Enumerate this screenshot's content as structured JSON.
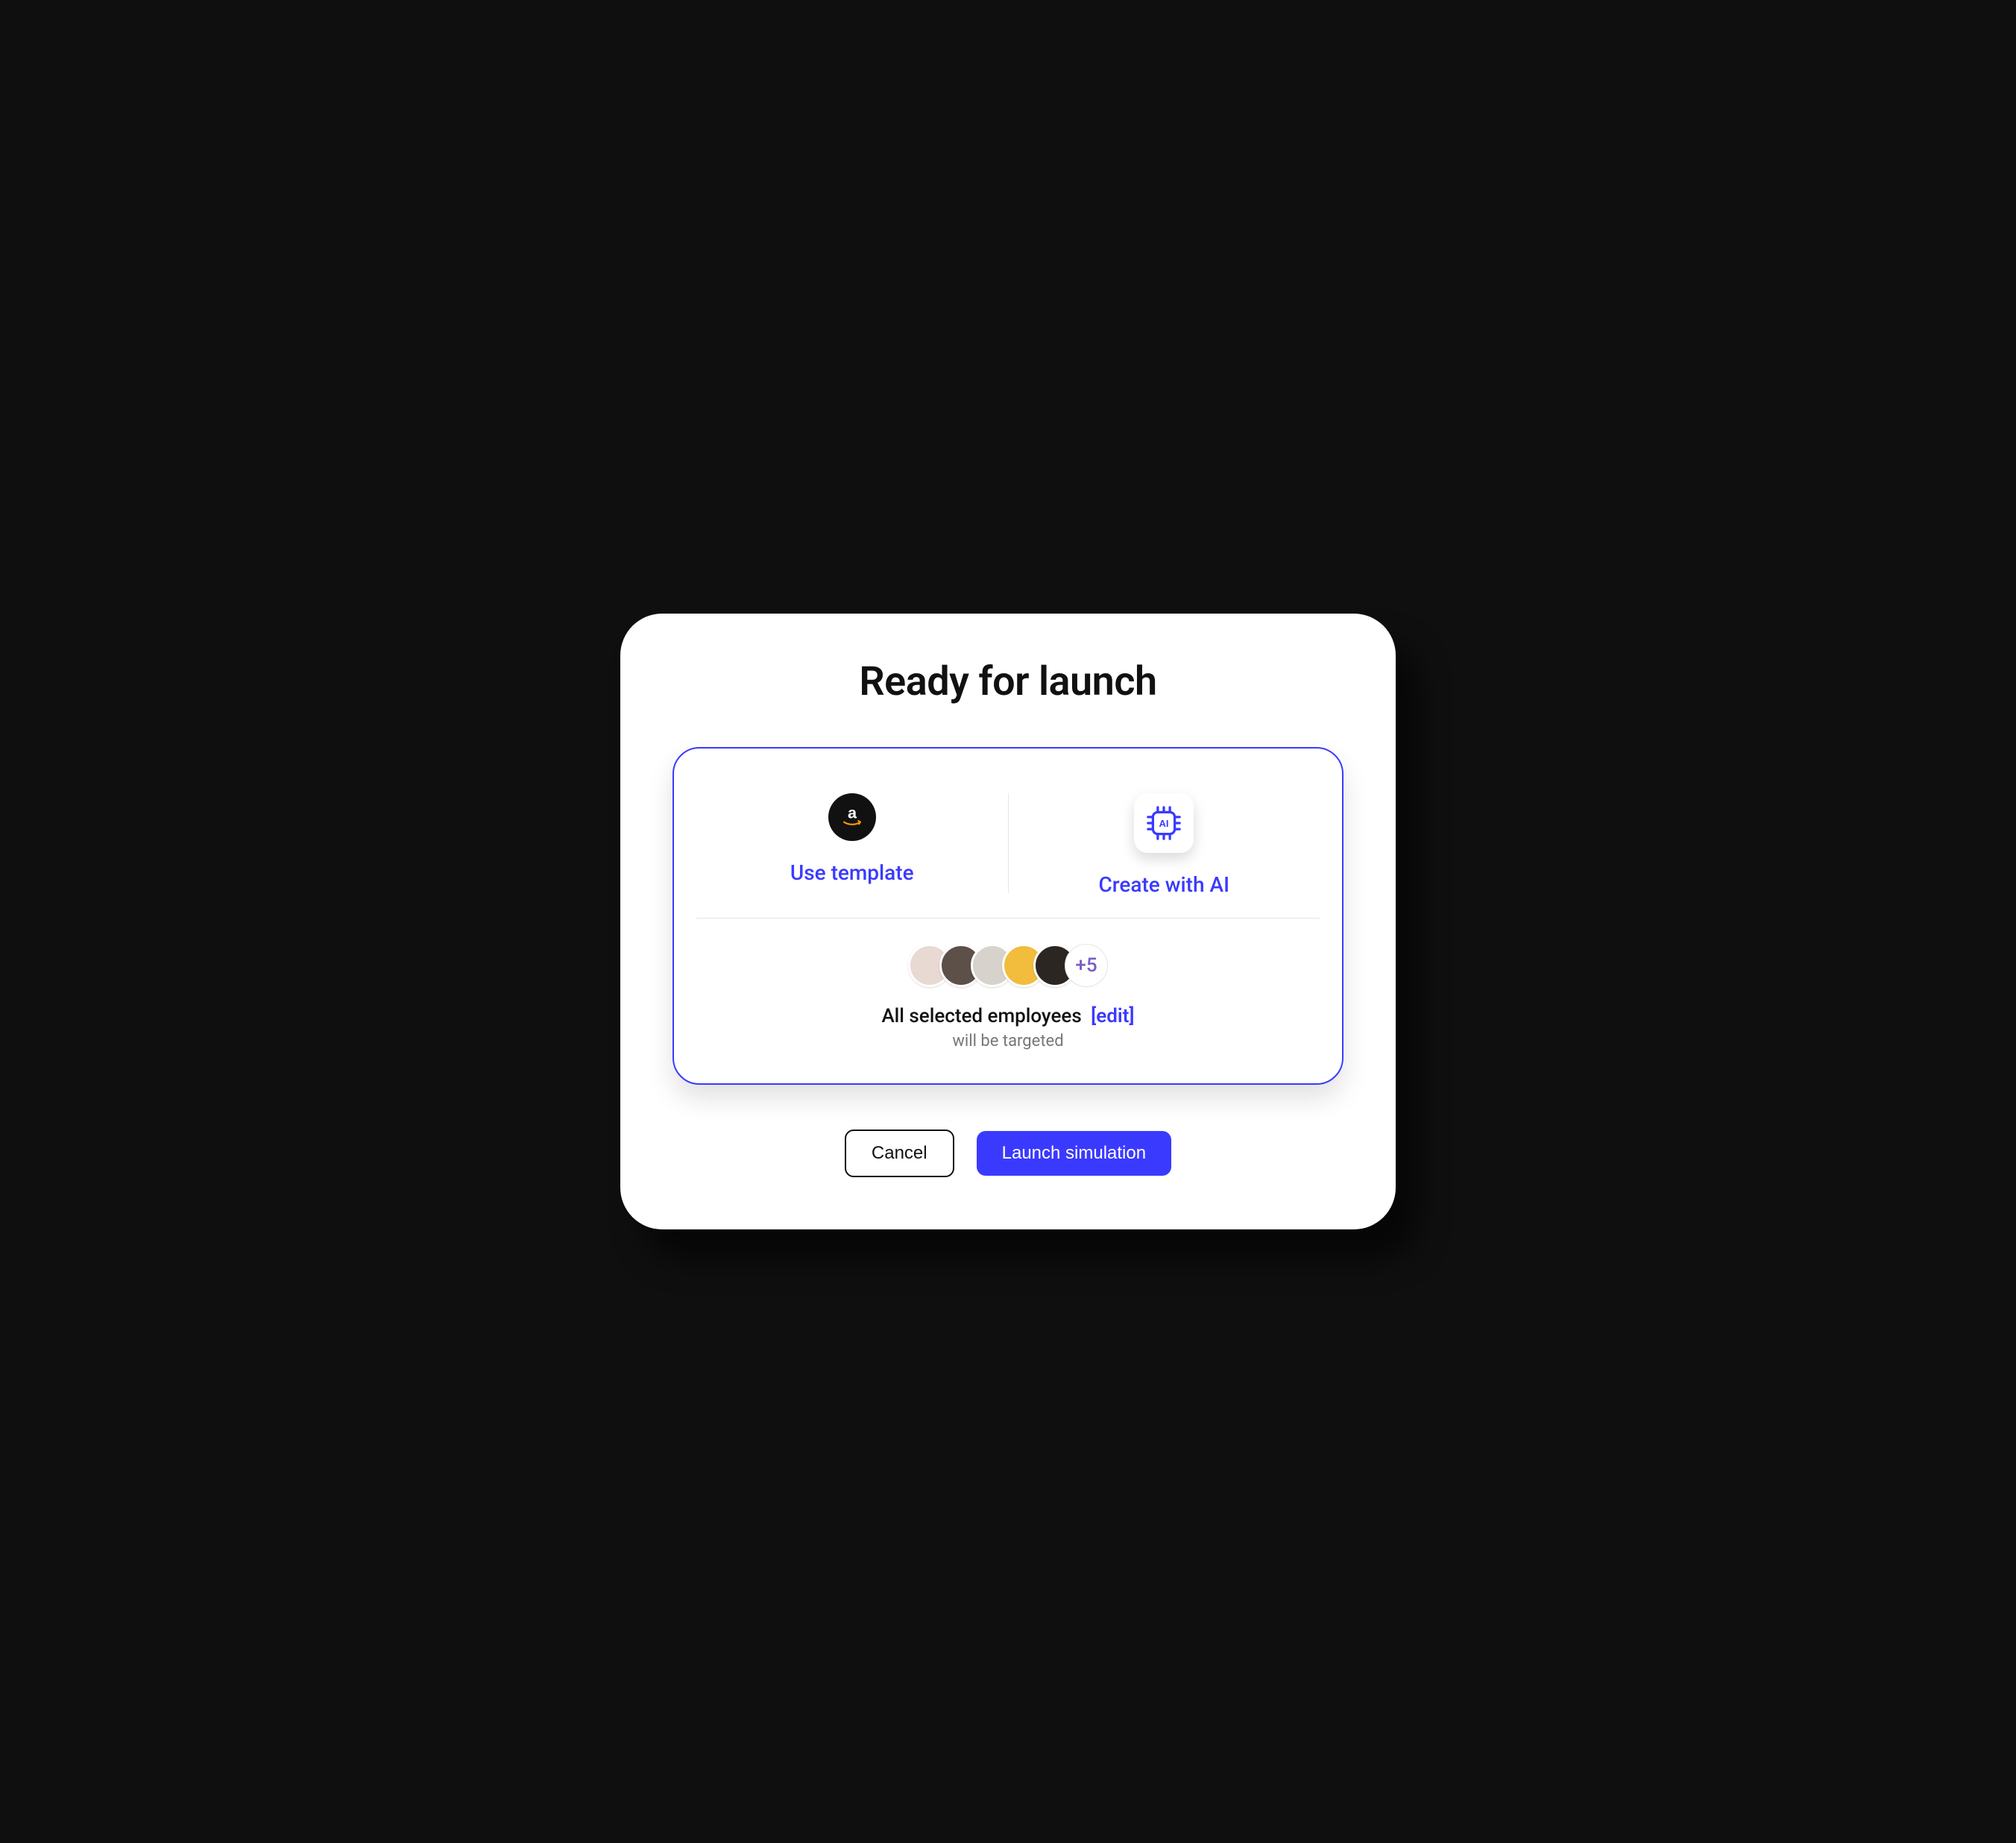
{
  "modal": {
    "title": "Ready for launch",
    "optionTemplate": {
      "label": "Use template",
      "iconName": "amazon-icon"
    },
    "optionAI": {
      "label": "Create with AI",
      "iconName": "ai-chip-icon"
    },
    "employees": {
      "overflowLabel": "+5",
      "line": "All selected employees",
      "editLabel": "[edit]",
      "subline": "will be targeted"
    },
    "actions": {
      "cancel": "Cancel",
      "launch": "Launch simulation"
    }
  },
  "colors": {
    "accent": "#3a3aff",
    "amazonBg": "#111111",
    "overflowText": "#7a5cc8"
  }
}
